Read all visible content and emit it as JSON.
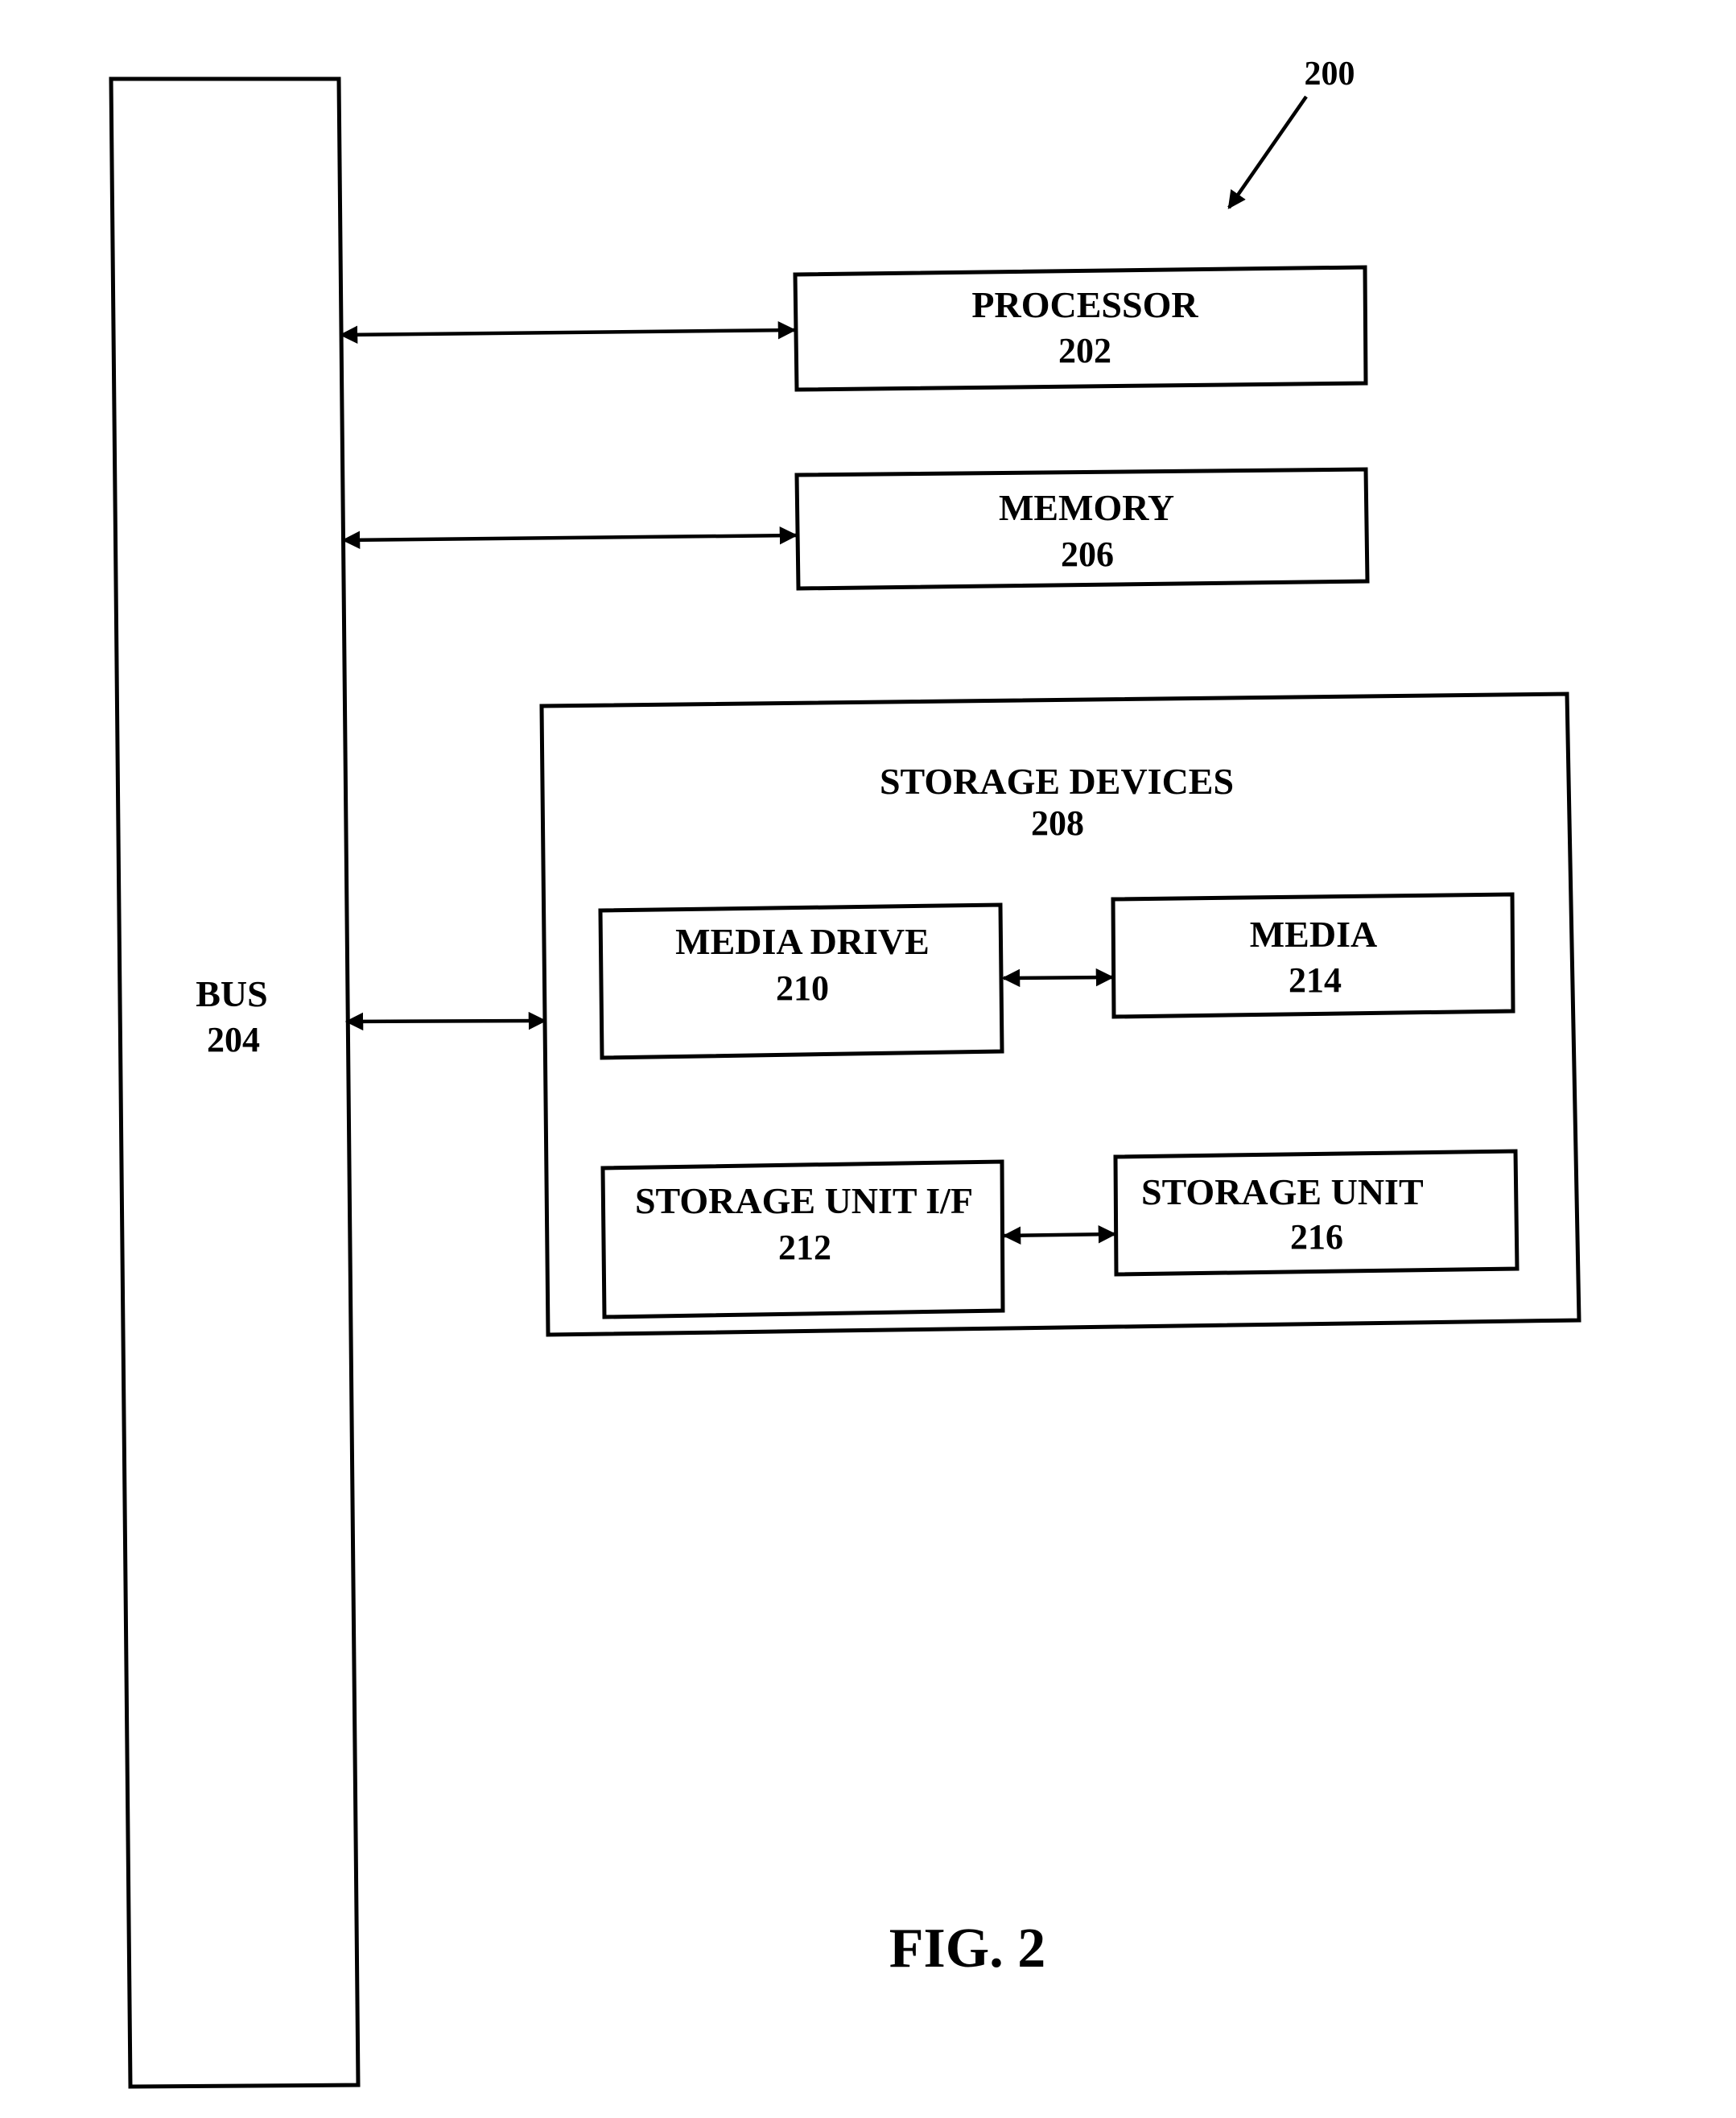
{
  "figure": {
    "reference": "200",
    "caption": "FIG. 2"
  },
  "colors": {
    "ink": "#000000",
    "background": "#ffffff"
  },
  "blocks": {
    "bus": {
      "name": "BUS",
      "ref": "204"
    },
    "processor": {
      "name": "PROCESSOR",
      "ref": "202"
    },
    "memory": {
      "name": "MEMORY",
      "ref": "206"
    },
    "storage_devices": {
      "name": "STORAGE DEVICES",
      "ref": "208"
    },
    "media_drive": {
      "name": "MEDIA DRIVE",
      "ref": "210"
    },
    "storage_unit_if": {
      "name": "STORAGE UNIT I/F",
      "ref": "212"
    },
    "media": {
      "name": "MEDIA",
      "ref": "214"
    },
    "storage_unit": {
      "name": "STORAGE UNIT",
      "ref": "216"
    }
  },
  "connections": [
    {
      "from": "BUS 204",
      "to": "PROCESSOR 202",
      "direction": "bidirectional"
    },
    {
      "from": "BUS 204",
      "to": "MEMORY 206",
      "direction": "bidirectional"
    },
    {
      "from": "BUS 204",
      "to": "STORAGE DEVICES 208",
      "direction": "bidirectional"
    },
    {
      "from": "MEDIA DRIVE 210",
      "to": "MEDIA 214",
      "direction": "bidirectional"
    },
    {
      "from": "STORAGE UNIT I/F 212",
      "to": "STORAGE UNIT 216",
      "direction": "bidirectional"
    }
  ]
}
